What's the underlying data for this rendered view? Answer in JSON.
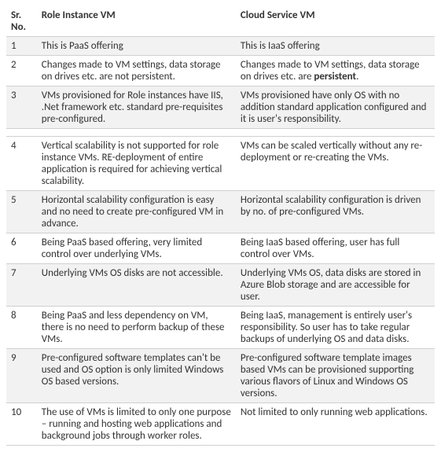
{
  "headers": {
    "sr": "Sr. No.",
    "role": "Role Instance VM",
    "cloud": "Cloud Service VM"
  },
  "rows": {
    "r1": {
      "no": "1",
      "role": "This is PaaS offering",
      "cloud": "This is IaaS offering"
    },
    "r2": {
      "no": "2",
      "role": "Changes made to VM settings, data storage on drives etc. are not persistent.",
      "cloud_pre": "Changes made to VM settings, data storage on drives etc. are ",
      "cloud_bold": "persistent",
      "cloud_post": "."
    },
    "r3": {
      "no": "3",
      "role": "VMs provisioned for Role instances have IIS, .Net framework etc. standard pre-requisites pre-configured.",
      "cloud": "VMs provisioned have only OS with no addition standard application configured and it is user's responsibility."
    },
    "r4": {
      "no": "4",
      "role": "Vertical scalability is not supported for role instance VMs. RE-deployment of entire application is required for achieving vertical scalability.",
      "cloud": "VMs can be scaled vertically without any re-deployment or re-creating the VMs."
    },
    "r5": {
      "no": "5",
      "role": "Horizontal scalability configuration is easy and no need to create pre-configured VM in advance.",
      "cloud": "Horizontal scalability configuration is driven by no. of pre-configured VMs."
    },
    "r6": {
      "no": "6",
      "role": "Being PaaS based offering, very limited control over underlying VMs.",
      "cloud": "Being IaaS based offering, user has full control over VMs."
    },
    "r7": {
      "no": "7",
      "role": "Underlying VMs OS disks are not accessible.",
      "cloud": "Underlying VMs OS, data disks are stored in Azure Blob storage and are accessible for user."
    },
    "r8": {
      "no": "8",
      "role": "Being PaaS and less dependency on VM, there is no need to perform backup of these VMs.",
      "cloud": "Being IaaS, management is entirely user's responsibility. So user has to take regular backups of underlying OS and data disks."
    },
    "r9": {
      "no": "9",
      "role": "Pre-configured software templates can't be used and OS option is only limited Windows OS based versions.",
      "cloud": "Pre-configured software template images based VMs can be provisioned supporting various flavors of Linux and Windows OS versions."
    },
    "r10": {
      "no": "10",
      "role": "The use of VMs is limited to only one purpose – running and hosting web applications and background jobs through worker roles.",
      "cloud": "Not limited to only running web applications."
    }
  }
}
